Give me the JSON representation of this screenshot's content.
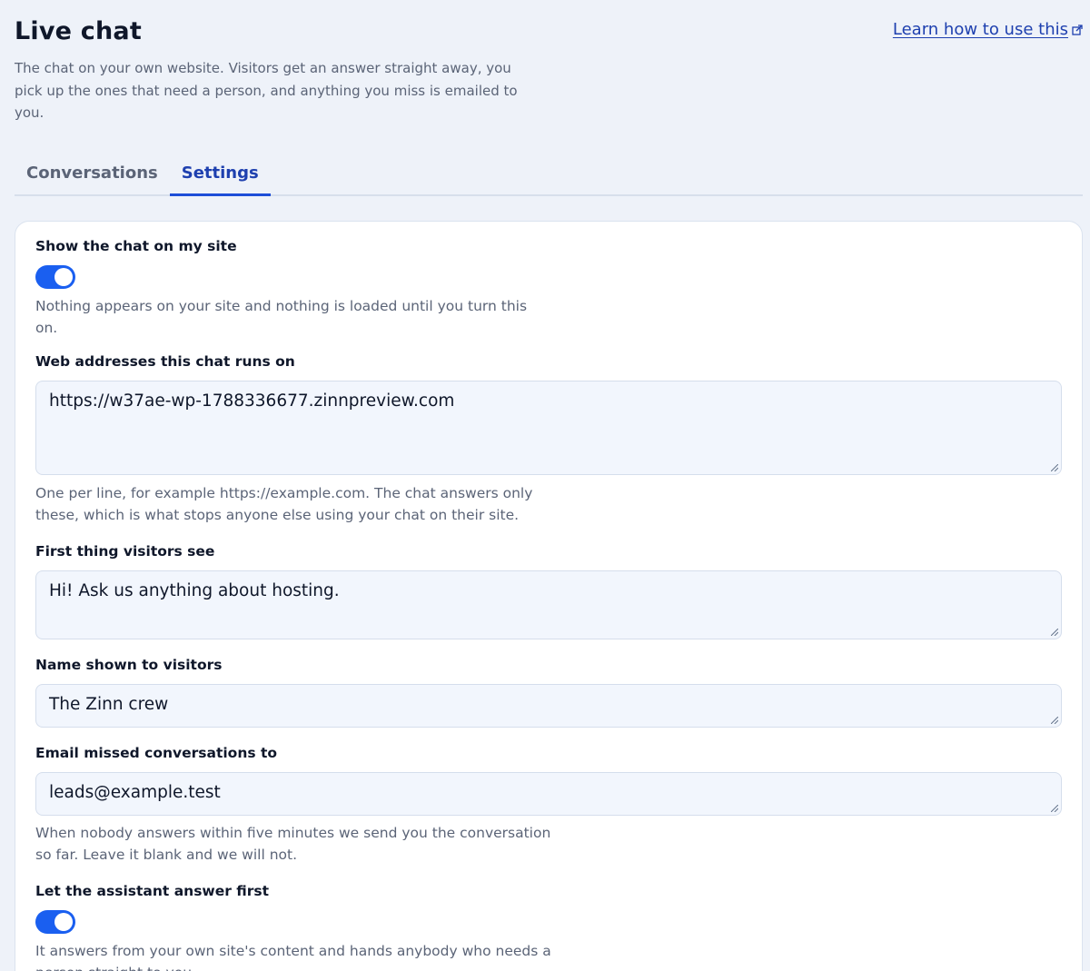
{
  "header": {
    "title": "Live chat",
    "description": "The chat on your own website. Visitors get an answer straight away, you pick up the ones that need a person, and anything you miss is emailed to you.",
    "help_link": "Learn how to use this"
  },
  "tabs": [
    {
      "label": "Conversations",
      "active": false
    },
    {
      "label": "Settings",
      "active": true
    }
  ],
  "settings": {
    "show_chat": {
      "label": "Show the chat on my site",
      "enabled": true,
      "help": "Nothing appears on your site and nothing is loaded until you turn this on."
    },
    "web_addresses": {
      "label": "Web addresses this chat runs on",
      "value": "https://w37ae-wp-1788336677.zinnpreview.com",
      "help": "One per line, for example https://example.com. The chat answers only these, which is what stops anyone else using your chat on their site."
    },
    "first_message": {
      "label": "First thing visitors see",
      "value": "Hi! Ask us anything about hosting."
    },
    "display_name": {
      "label": "Name shown to visitors",
      "value": "The Zinn crew"
    },
    "missed_email": {
      "label": "Email missed conversations to",
      "value": "leads@example.test",
      "help": "When nobody answers within five minutes we send you the conversation so far. Leave it blank and we will not."
    },
    "assistant_first": {
      "label": "Let the assistant answer first",
      "enabled": true,
      "help": "It answers from your own site's content and hands anybody who needs a person straight to you."
    }
  },
  "colors": {
    "accent": "#1a5ff0",
    "link": "#1e40af",
    "page_bg": "#eef2f9",
    "field_bg": "#f2f6fd"
  },
  "icons": {
    "help_link": "external-link-icon",
    "textarea_corner": "resize-grip-icon"
  }
}
